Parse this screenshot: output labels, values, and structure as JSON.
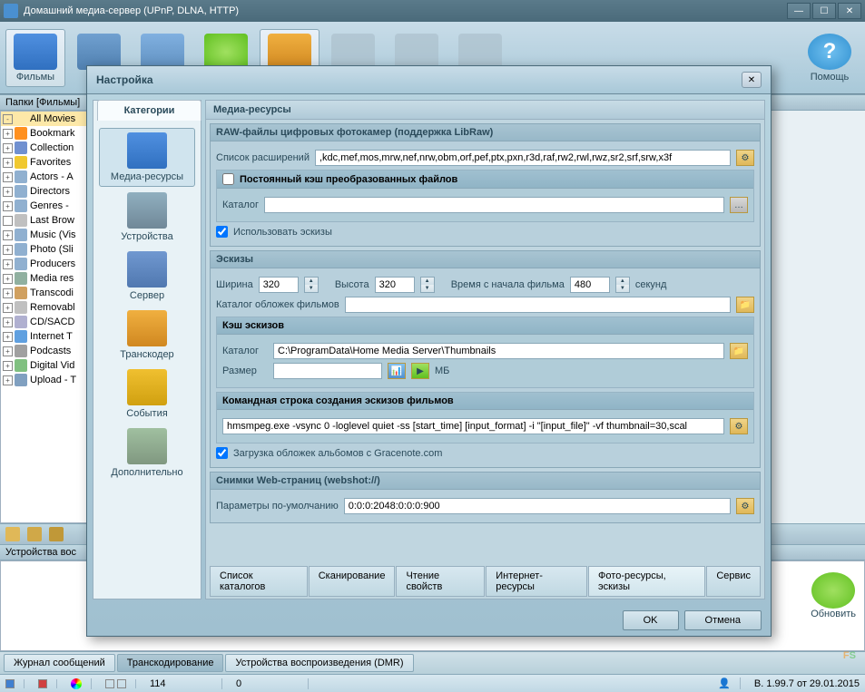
{
  "window": {
    "title": "Домашний медиа-сервер (UPnP, DLNA, HTTP)"
  },
  "toolbar": {
    "films": "Фильмы",
    "help": "Помощь"
  },
  "folders": {
    "header": "Папки [Фильмы]",
    "items": [
      {
        "label": "All Movies",
        "color": "#fde8a8",
        "sel": true,
        "plus": "-"
      },
      {
        "label": "Bookmark",
        "color": "#ff9020"
      },
      {
        "label": "Collection",
        "color": "#7090d0"
      },
      {
        "label": "Favorites",
        "color": "#f0c830"
      },
      {
        "label": "Actors - A",
        "color": "#90b0d0"
      },
      {
        "label": "Directors",
        "color": "#90b0d0"
      },
      {
        "label": "Genres -",
        "color": "#90b0d0"
      },
      {
        "label": "Last Brow",
        "color": "#c0c0c0",
        "plus": ""
      },
      {
        "label": "Music (Vis",
        "color": "#90b0d0"
      },
      {
        "label": "Photo (Sli",
        "color": "#90b0d0"
      },
      {
        "label": "Producers",
        "color": "#90b0d0"
      },
      {
        "label": "Media res",
        "color": "#90b0a0"
      },
      {
        "label": "Transcodi",
        "color": "#d0a060"
      },
      {
        "label": "Removabl",
        "color": "#c0c0c0"
      },
      {
        "label": "CD/SACD",
        "color": "#b0b0d0"
      },
      {
        "label": "Internet T",
        "color": "#60a0e0"
      },
      {
        "label": "Podcasts",
        "color": "#a0a0a0"
      },
      {
        "label": "Digital Vid",
        "color": "#80c080"
      },
      {
        "label": "Upload - T",
        "color": "#80a0c0"
      }
    ]
  },
  "devices_label": "Устройства вос",
  "bottom_tabs": {
    "t1": "Журнал сообщений",
    "t2": "Транскодирование",
    "t3": "Устройства воспроизведения (DMR)"
  },
  "statusbar": {
    "count": "114",
    "size": "0",
    "version": "В. 1.99.7 от 29.01.2015"
  },
  "modal": {
    "title": "Настройка",
    "cat_header": "Категории",
    "categories": [
      "Медиа-ресурсы",
      "Устройства",
      "Сервер",
      "Транскодер",
      "События",
      "Дополнительно"
    ],
    "settings_title": "Медиа-ресурсы",
    "raw": {
      "title": "RAW-файлы цифровых фотокамер (поддержка LibRaw)",
      "list_label": "Список расширений",
      "list_value": ",kdc,mef,mos,mrw,nef,nrw,obm,orf,pef,ptx,pxn,r3d,raf,rw2,rwl,rwz,sr2,srf,srw,x3f",
      "cache_cb": "Постоянный кэш преобразованных файлов",
      "catalog_label": "Каталог",
      "use_thumbs": "Использовать эскизы"
    },
    "thumbs": {
      "title": "Эскизы",
      "width_label": "Ширина",
      "width": "320",
      "height_label": "Высота",
      "height": "320",
      "time_label": "Время с начала фильма",
      "time": "480",
      "seconds": "секунд",
      "covers_label": "Каталог обложек фильмов"
    },
    "cache": {
      "title": "Кэш эскизов",
      "catalog_label": "Каталог",
      "catalog_value": "C:\\ProgramData\\Home Media Server\\Thumbnails",
      "size_label": "Размер",
      "mb": "МБ"
    },
    "cmdline": {
      "title": "Командная строка создания эскизов фильмов",
      "value": "hmsmpeg.exe -vsync 0 -loglevel quiet -ss [start_time] [input_format] -i \"[input_file]\" -vf thumbnail=30,scal",
      "gracenote_cb": "Загрузка обложек альбомов с Gracenote.com"
    },
    "webshot": {
      "title": "Снимки Web-страниц (webshot://)",
      "params_label": "Параметры по-умолчанию",
      "params_value": "0:0:0:2048:0:0:0:900"
    },
    "tabs": [
      "Список каталогов",
      "Сканирование",
      "Чтение свойств",
      "Интернет-ресурсы",
      "Фото-ресурсы, эскизы",
      "Сервис"
    ],
    "ok": "OK",
    "cancel": "Отмена"
  },
  "refresh": "Обновить"
}
